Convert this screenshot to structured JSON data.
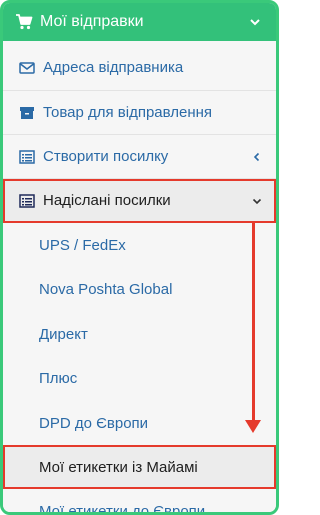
{
  "header": {
    "title": "Мої відправки",
    "icon": "cart-icon"
  },
  "menu": [
    {
      "label": "Адреса відправника",
      "icon": "envelope-icon"
    },
    {
      "label": "Товар для відправлення",
      "icon": "box-icon"
    },
    {
      "label": "Створити посилку",
      "icon": "list-icon",
      "indicator": "chevron-left-icon"
    },
    {
      "label": "Надіслані посилки",
      "icon": "list-icon",
      "indicator": "chevron-down-icon",
      "active": true
    }
  ],
  "submenu": [
    {
      "label": "UPS / FedEx"
    },
    {
      "label": "Nova Poshta Global"
    },
    {
      "label": "Директ"
    },
    {
      "label": "Плюс"
    },
    {
      "label": "DPD до Європи"
    },
    {
      "label": "Мої етикетки із Майамі",
      "active": true
    },
    {
      "label": "Мої етикетки до Європи"
    }
  ],
  "colors": {
    "header_green": "#33c17a",
    "link_blue": "#2b6aa6",
    "highlight_red": "#e53a2c"
  }
}
